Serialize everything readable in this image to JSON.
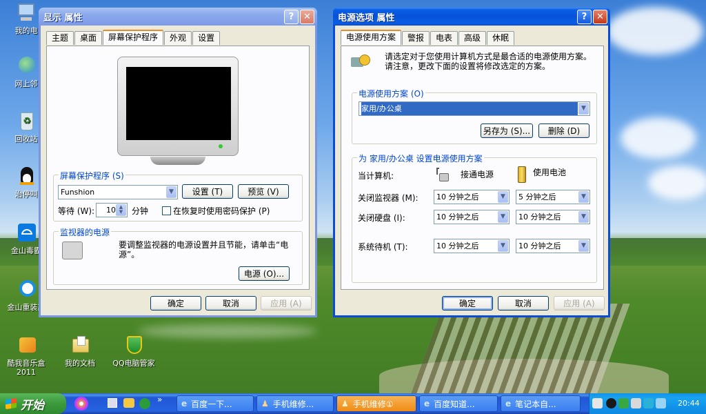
{
  "desktop": {
    "icons": [
      {
        "label": "我的电",
        "name": "my-computer-icon"
      },
      {
        "label": "网上邻",
        "name": "network-places-icon"
      },
      {
        "label": "回收站",
        "name": "recycle-bin-icon"
      },
      {
        "label": "治停叫",
        "name": "qq-icon"
      },
      {
        "label": "金山毒霸",
        "name": "kingsoft-antivirus-icon"
      },
      {
        "label": "金山重装高",
        "name": "kingsoft-reinstall-icon"
      },
      {
        "label": "酷我音乐盒\n2011",
        "name": "kuwo-music-icon"
      },
      {
        "label": "我的文档",
        "name": "my-documents-icon"
      },
      {
        "label": "QQ电脑管家",
        "name": "qq-pc-manager-icon"
      }
    ]
  },
  "display_window": {
    "title": "显示 属性",
    "help": "?",
    "close": "✕",
    "tabs": [
      "主题",
      "桌面",
      "屏幕保护程序",
      "外观",
      "设置"
    ],
    "screensaver_group": "屏幕保护程序 (S)",
    "screensaver_value": "Funshion",
    "settings_btn": "设置 (T)",
    "preview_btn": "预览 (V)",
    "wait_label": "等待 (W):",
    "wait_value": "10",
    "wait_unit": "分钟",
    "password_checkbox": "在恢复时使用密码保护 (P)",
    "power_group": "监视器的电源",
    "power_text": "要调整监视器的电源设置并且节能，请单击“电源”。",
    "power_btn": "电源 (O)...",
    "ok": "确定",
    "cancel": "取消",
    "apply": "应用 (A)"
  },
  "power_window": {
    "title": "电源选项 属性",
    "help": "?",
    "close": "✕",
    "tabs": [
      "电源使用方案",
      "警报",
      "电表",
      "高级",
      "休眠"
    ],
    "intro": "请选定对于您使用计算机方式是最合适的电源使用方案。请注意，更改下面的设置将修改选定的方案。",
    "scheme_group": "电源使用方案 (O)",
    "scheme_value": "家用/办公桌",
    "saveas_btn": "另存为 (S)...",
    "delete_btn": "删除 (D)",
    "settings_group": "为 家用/办公桌 设置电源使用方案",
    "computer_label": "当计算机:",
    "plugged_label": "接通电源",
    "battery_label": "使用电池",
    "rows": [
      {
        "label": "关闭监视器 (M):",
        "ac": "10 分钟之后",
        "dc": "5 分钟之后"
      },
      {
        "label": "关闭硬盘 (I):",
        "ac": "10 分钟之后",
        "dc": "10 分钟之后"
      },
      {
        "label": "系统待机 (T):",
        "ac": "10 分钟之后",
        "dc": "10 分钟之后"
      }
    ],
    "ok": "确定",
    "cancel": "取消",
    "apply": "应用 (A)"
  },
  "taskbar": {
    "start": "开始",
    "quicklaunch_more": "»",
    "tasks": [
      "百度一下...",
      "手机维修...",
      "手机维修①",
      "百度知道...",
      "笔记本自..."
    ],
    "clock": "20:44"
  }
}
